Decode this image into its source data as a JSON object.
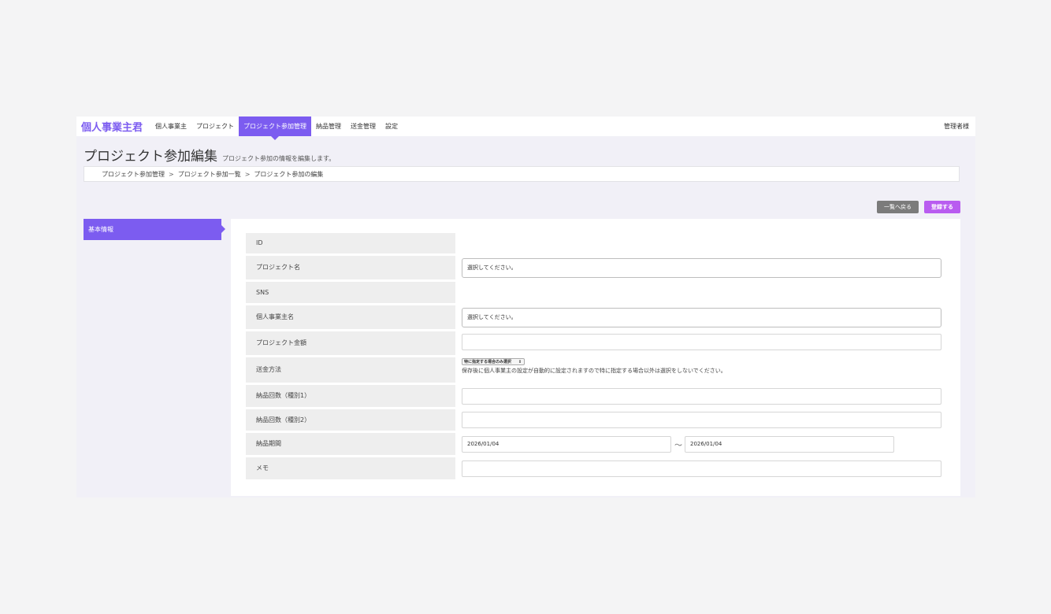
{
  "brand": "個人事業主君",
  "nav": {
    "items": [
      "個人事業主",
      "プロジェクト",
      "プロジェクト参加管理",
      "納品管理",
      "送金管理",
      "設定"
    ],
    "user": "管理者様"
  },
  "page": {
    "title": "プロジェクト参加編集",
    "subtitle": "プロジェクト参加の情報を編集します。"
  },
  "breadcrumb": [
    "プロジェクト参加管理",
    "プロジェクト参加一覧",
    "プロジェクト参加の編集"
  ],
  "breadcrumb_sep": ">",
  "actions": {
    "back": "一覧へ戻る",
    "save": "登録する"
  },
  "sidebar": {
    "tab": "基本情報"
  },
  "form": {
    "id": {
      "label": "ID"
    },
    "project": {
      "label": "プロジェクト名",
      "value": "選択してください。"
    },
    "sns": {
      "label": "SNS"
    },
    "owner": {
      "label": "個人事業主名",
      "value": "選択してください。"
    },
    "amount": {
      "label": "プロジェクト金額",
      "value": ""
    },
    "method": {
      "label": "送金方法",
      "value": "特に指定する場合のみ選択",
      "note": "保存後に個人事業主の設定が自動的に設定されますので特に指定する場合以外は選択をしないでください。"
    },
    "count1": {
      "label": "納品回数（種別1）",
      "value": ""
    },
    "count2": {
      "label": "納品回数（種別2）",
      "value": ""
    },
    "period": {
      "label": "納品期間",
      "start": "2026/01/04",
      "separator": "〜",
      "end": "2026/01/04"
    },
    "memo": {
      "label": "メモ",
      "value": ""
    }
  }
}
